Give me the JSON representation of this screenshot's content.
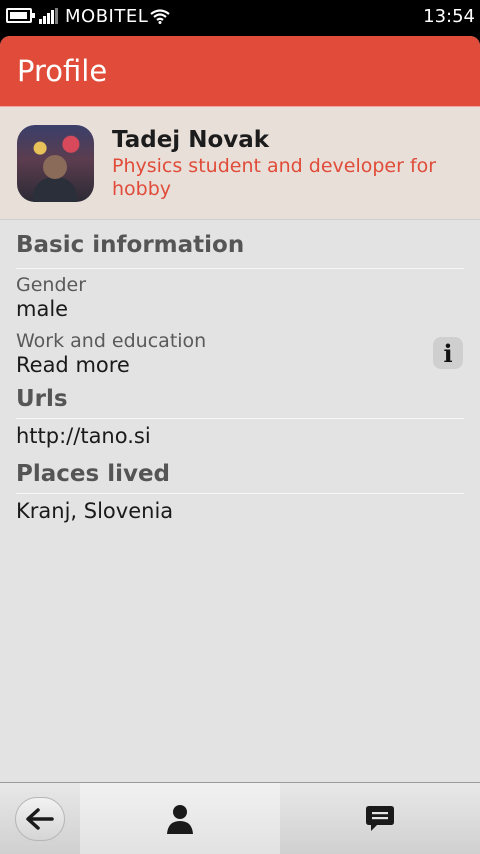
{
  "status_bar": {
    "carrier": "MOBITEL",
    "time": "13:54",
    "battery_icon": "battery-icon",
    "signal_icon": "signal-icon",
    "wifi_icon": "wifi-icon"
  },
  "app": {
    "title": "Profile",
    "accent_color": "#e04c39"
  },
  "profile": {
    "name": "Tadej Novak",
    "tagline": "Physics student and developer for hobby"
  },
  "sections": {
    "basic": {
      "title": "Basic information",
      "gender_label": "Gender",
      "gender_value": "male",
      "work_label": "Work and education",
      "work_value": "Read more",
      "info_icon": "info-icon"
    },
    "urls": {
      "title": "Urls",
      "items": [
        "http://tano.si"
      ]
    },
    "places": {
      "title": "Places lived",
      "items": [
        "Kranj, Slovenia"
      ]
    }
  },
  "toolbar": {
    "back_icon": "back-arrow-icon",
    "profile_icon": "person-icon",
    "chat_icon": "chat-bubble-icon"
  }
}
